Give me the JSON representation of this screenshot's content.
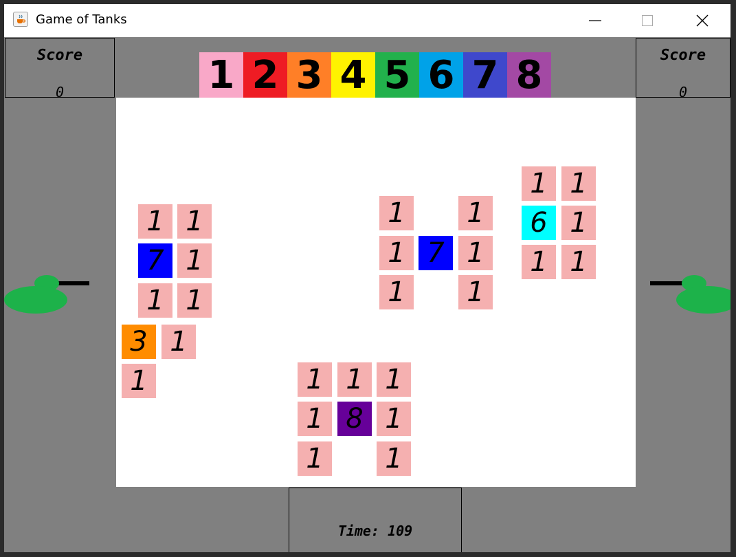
{
  "window": {
    "title": "Game of Tanks"
  },
  "colors": {
    "c1": "#f9a8c8",
    "c2": "#ee1c24",
    "c3": "#ff7f27",
    "c4": "#fff200",
    "c5": "#22b14c",
    "c6": "#00a2e8",
    "c7": "#3f48cc",
    "c8": "#a349a4",
    "tile_default": "#f5b0b0",
    "blue_tile": "#0000ff",
    "cyan_tile": "#00ffff",
    "orange_tile": "#ff8c00",
    "purple_tile": "#660099",
    "tank": "#1db24a"
  },
  "scores": {
    "left": {
      "label": "Score",
      "value": "0"
    },
    "right": {
      "label": "Score",
      "value": "0"
    }
  },
  "palette": [
    "1",
    "2",
    "3",
    "4",
    "5",
    "6",
    "7",
    "8"
  ],
  "tiles": [
    {
      "text": "1",
      "c": "tile_default"
    },
    {
      "text": "1",
      "c": "tile_default"
    },
    {
      "text": "7",
      "c": "blue_tile"
    },
    {
      "text": "1",
      "c": "tile_default"
    },
    {
      "text": "1",
      "c": "tile_default"
    },
    {
      "text": "1",
      "c": "tile_default"
    },
    {
      "text": "3",
      "c": "orange_tile"
    },
    {
      "text": "1",
      "c": "tile_default"
    },
    {
      "text": "1",
      "c": "tile_default"
    },
    {
      "text": "1",
      "c": "tile_default"
    },
    {
      "text": "1",
      "c": "tile_default"
    },
    {
      "text": "1",
      "c": "tile_default"
    },
    {
      "text": "7",
      "c": "blue_tile"
    },
    {
      "text": "1",
      "c": "tile_default"
    },
    {
      "text": "1",
      "c": "tile_default"
    },
    {
      "text": "1",
      "c": "tile_default"
    },
    {
      "text": "1",
      "c": "tile_default"
    },
    {
      "text": "1",
      "c": "tile_default"
    },
    {
      "text": "6",
      "c": "cyan_tile"
    },
    {
      "text": "1",
      "c": "tile_default"
    },
    {
      "text": "1",
      "c": "tile_default"
    },
    {
      "text": "1",
      "c": "tile_default"
    },
    {
      "text": "1",
      "c": "tile_default"
    },
    {
      "text": "1",
      "c": "tile_default"
    },
    {
      "text": "1",
      "c": "tile_default"
    },
    {
      "text": "1",
      "c": "tile_default"
    },
    {
      "text": "8",
      "c": "purple_tile"
    },
    {
      "text": "1",
      "c": "tile_default"
    },
    {
      "text": "1",
      "c": "tile_default"
    },
    {
      "text": "1",
      "c": "tile_default"
    }
  ],
  "timer": {
    "text": "Time: 109"
  }
}
